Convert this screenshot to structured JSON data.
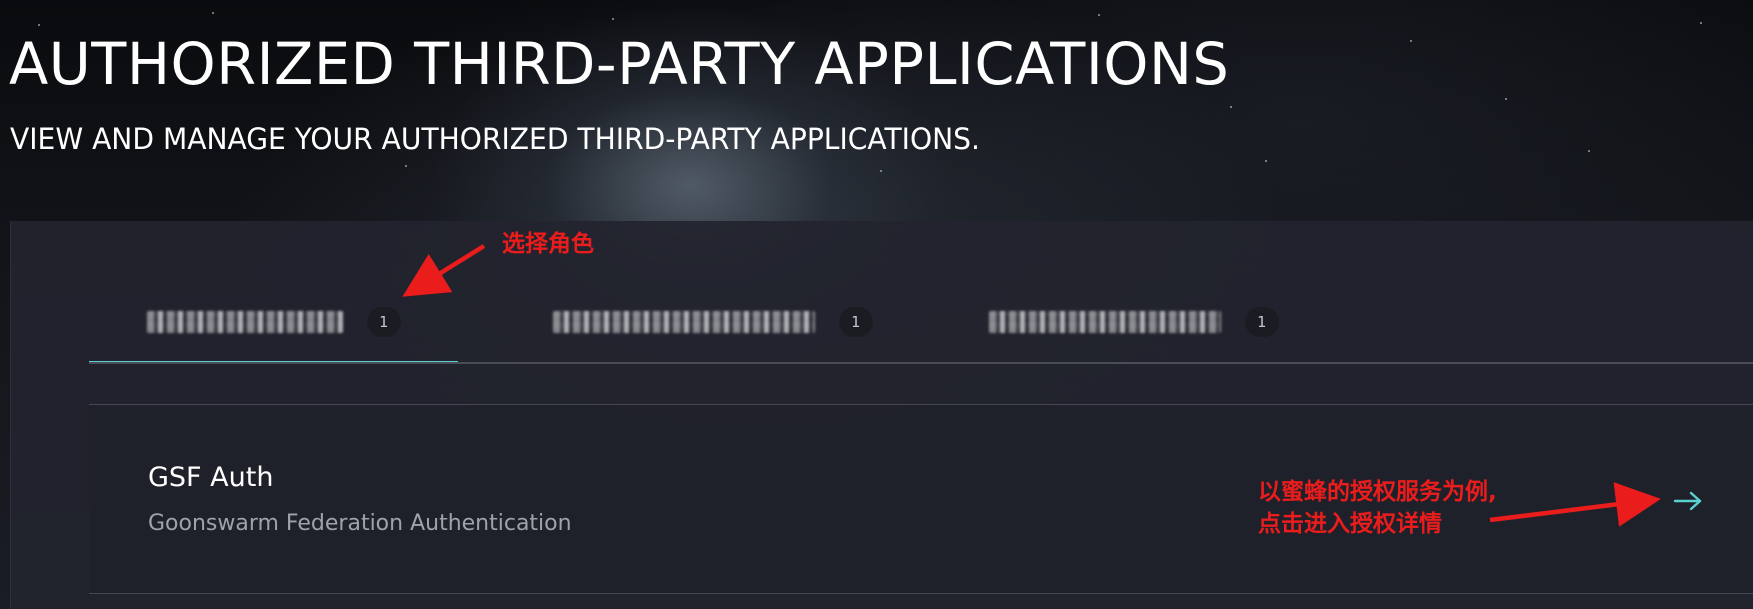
{
  "page": {
    "title": "AUTHORIZED THIRD-PARTY APPLICATIONS",
    "subtitle": "VIEW AND MANAGE YOUR AUTHORIZED THIRD-PARTY APPLICATIONS."
  },
  "tabs": [
    {
      "name": "",
      "count": "1",
      "active": true
    },
    {
      "name": "",
      "count": "1",
      "active": false
    },
    {
      "name": "",
      "count": "1",
      "active": false
    }
  ],
  "applications": [
    {
      "name": "GSF Auth",
      "description": "Goonswarm Federation Authentication",
      "arrow_icon": "arrow-right-icon"
    }
  ],
  "annotations": {
    "select_character": "选择角色",
    "gsf_hint_line1": "以蜜蜂的授权服务为例,",
    "gsf_hint_line2": "点击进入授权详情"
  },
  "colors": {
    "accent": "#5bd0d0",
    "annotation": "#ea1c1c",
    "panel": "#22242e",
    "title": "#ffffff",
    "description": "#9ea2ab"
  }
}
